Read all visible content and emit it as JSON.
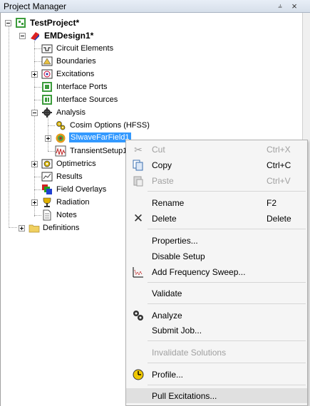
{
  "window": {
    "title": "Project Manager",
    "pin_glyph": "ᵖ",
    "close_glyph": "×"
  },
  "tree": {
    "project": "TestProject*",
    "design": "EMDesign1*",
    "items": {
      "circuit_elements": "Circuit Elements",
      "boundaries": "Boundaries",
      "excitations": "Excitations",
      "interface_ports": "Interface Ports",
      "interface_sources": "Interface Sources",
      "analysis": "Analysis",
      "cosim_options": "Cosim Options (HFSS)",
      "siwave_farfield": "SIwaveFarField1",
      "transient_setup": "TransientSetup1",
      "optimetrics": "Optimetrics",
      "results": "Results",
      "field_overlays": "Field Overlays",
      "radiation": "Radiation",
      "notes": "Notes",
      "definitions": "Definitions"
    }
  },
  "context_menu": {
    "cut": {
      "label": "Cut",
      "shortcut": "Ctrl+X"
    },
    "copy": {
      "label": "Copy",
      "shortcut": "Ctrl+C"
    },
    "paste": {
      "label": "Paste",
      "shortcut": "Ctrl+V"
    },
    "rename": {
      "label": "Rename",
      "shortcut": "F2"
    },
    "delete": {
      "label": "Delete",
      "shortcut": "Delete"
    },
    "properties": {
      "label": "Properties..."
    },
    "disable_setup": {
      "label": "Disable Setup"
    },
    "add_freq_sweep": {
      "label": "Add Frequency Sweep..."
    },
    "validate": {
      "label": "Validate"
    },
    "analyze": {
      "label": "Analyze"
    },
    "submit_job": {
      "label": "Submit Job..."
    },
    "invalidate_solutions": {
      "label": "Invalidate Solutions"
    },
    "profile": {
      "label": "Profile..."
    },
    "pull_excitations": {
      "label": "Pull Excitations..."
    }
  },
  "colors": {
    "selection": "#3399ff",
    "menu_background": "#f5f5f5",
    "disabled_text": "#a0a0a0"
  }
}
